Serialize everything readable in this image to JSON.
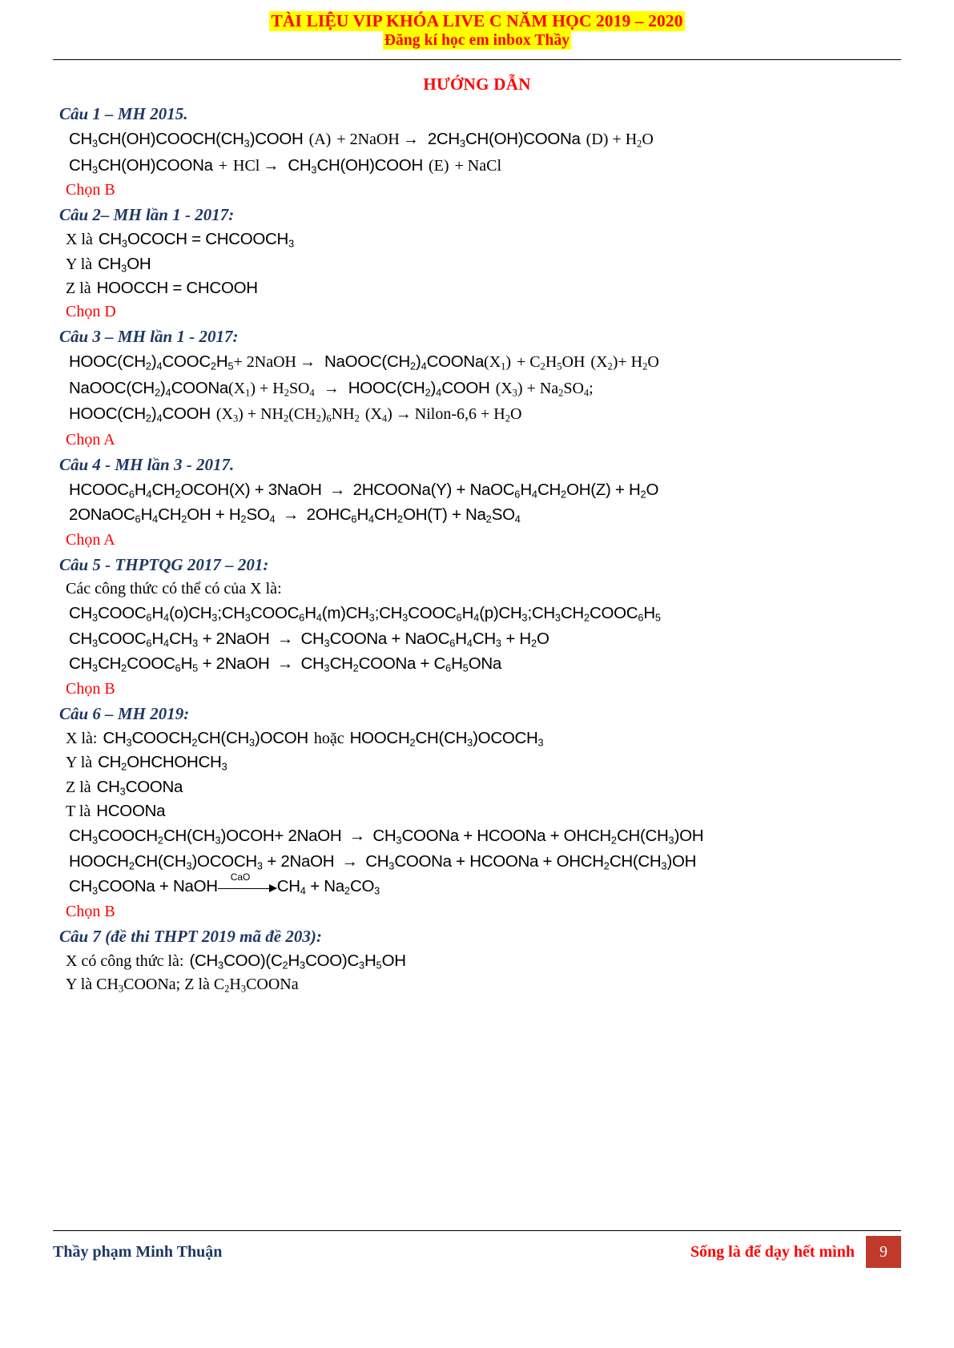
{
  "header": {
    "line1": "TÀI LIỆU VIP KHÓA LIVE C NĂM HỌC 2019 – 2020",
    "line2": "Đăng kí học em inbox Thầy",
    "highlight_color": "#ffff00",
    "text_color": "#ff0000"
  },
  "doc_title": "HƯỚNG DẪN",
  "colors": {
    "question_heading": "#1f3864",
    "answer": "#ff0000",
    "page_badge": "#c0392b"
  },
  "questions": [
    {
      "heading": "Câu 1 – MH 2015.",
      "answer": "Chọn B",
      "lines": [
        {
          "type": "equation",
          "id": "q1-eq1"
        },
        {
          "type": "equation",
          "id": "q1-eq2"
        }
      ]
    },
    {
      "heading": "Câu 2– MH lần 1 - 2017:",
      "answer": "Chọn D",
      "labels": {
        "x": "X là",
        "y": "Y là",
        "z": "Z là"
      }
    },
    {
      "heading": "Câu 3 – MH lần 1 - 2017:",
      "answer": "Chọn A"
    },
    {
      "heading": "Câu 4 - MH lần 3 - 2017.",
      "answer": "Chọn A"
    },
    {
      "heading": "Câu 5 - THPTQG 2017 – 201:",
      "answer": "Chọn B",
      "intro": "Các công thức có thể có của X là:"
    },
    {
      "heading": "Câu 6 – MH 2019:",
      "answer": "Chọn B",
      "labels": {
        "x": "X là:",
        "y": "Y là",
        "z": "Z là",
        "t": "T là"
      },
      "hoac": "hoặc",
      "catalyst": "CaO"
    },
    {
      "heading": "Câu 7 (đề thi THPT 2019 mã đề 203):",
      "intro_x": "X có công thức là:",
      "intro_yz": "Y là CH3COONa; Z là C2H3COONa"
    }
  ],
  "footer": {
    "author": "Thầy phạm Minh Thuận",
    "slogan": "Sống là để dạy hết mình",
    "page": "9"
  }
}
